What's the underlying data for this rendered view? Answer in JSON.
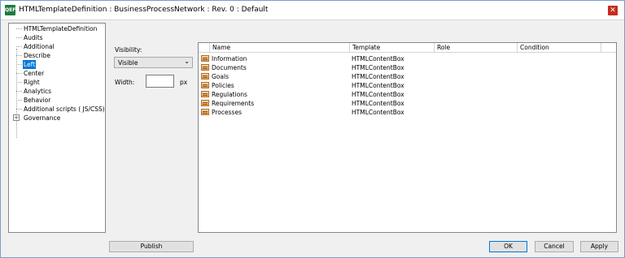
{
  "window": {
    "title": "HTMLTemplateDefinition : BusinessProcessNetwork : Rev. 0  : Default",
    "app_icon_text": "QEF"
  },
  "tree": {
    "items": [
      {
        "label": "HTMLTemplateDefinition"
      },
      {
        "label": "Audits"
      },
      {
        "label": "Additional"
      },
      {
        "label": "Describe"
      },
      {
        "label": "Left",
        "selected": true
      },
      {
        "label": "Center"
      },
      {
        "label": "Right"
      },
      {
        "label": "Analytics"
      },
      {
        "label": "Behavior"
      },
      {
        "label": "Additional scripts ( JS/CSS)"
      },
      {
        "label": "Governance",
        "expander": "+"
      }
    ]
  },
  "visibility": {
    "label": "Visibility:",
    "value": "Visible"
  },
  "width": {
    "label": "Width:",
    "value": "",
    "unit": "px"
  },
  "grid": {
    "columns": [
      "Name",
      "Template",
      "Role",
      "Condition"
    ],
    "rows": [
      {
        "name": "Information",
        "template": "HTMLContentBox",
        "role": "",
        "condition": ""
      },
      {
        "name": "Documents",
        "template": "HTMLContentBox",
        "role": "",
        "condition": ""
      },
      {
        "name": "Goals",
        "template": "HTMLContentBox",
        "role": "",
        "condition": ""
      },
      {
        "name": "Policies",
        "template": "HTMLContentBox",
        "role": "",
        "condition": ""
      },
      {
        "name": "Regulations",
        "template": "HTMLContentBox",
        "role": "",
        "condition": ""
      },
      {
        "name": "Requirements",
        "template": "HTMLContentBox",
        "role": "",
        "condition": ""
      },
      {
        "name": "Processes",
        "template": "HTMLContentBox",
        "role": "",
        "condition": ""
      }
    ]
  },
  "buttons": {
    "publish": "Publish",
    "ok": "OK",
    "cancel": "Cancel",
    "apply": "Apply"
  },
  "colors": {
    "selection": "#0078d7",
    "close": "#c42b1c",
    "app_icon": "#1f7a3e"
  }
}
